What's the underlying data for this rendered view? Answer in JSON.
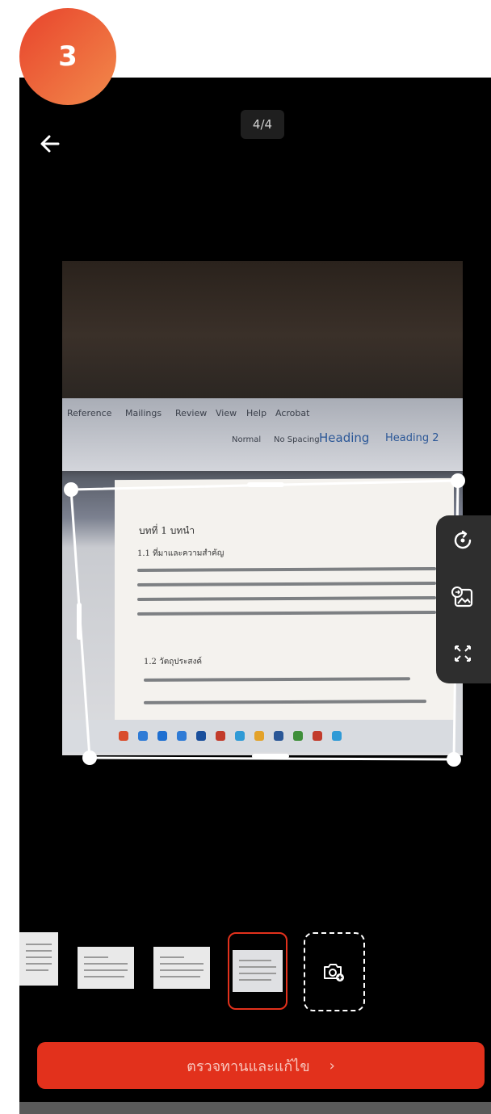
{
  "step": {
    "number": "3"
  },
  "header": {
    "back_icon": "arrow-left-icon",
    "page_indicator": "4/4"
  },
  "document_photo": {
    "ribbon_tabs": [
      "Reference",
      "Mailings",
      "Review",
      "View",
      "Help",
      "Acrobat"
    ],
    "styles": [
      "Normal",
      "No Spacing",
      "Heading",
      "Heading 2"
    ],
    "heading": "บทที่ 1 บทนำ",
    "section_1": "1.1 ที่มาและความสำคัญ",
    "section_2": "1.2 วัตถุประสงค์"
  },
  "toolbar": {
    "rotate_icon": "rotate-icon",
    "image_filter_icon": "image-filter-icon",
    "auto_crop_icon": "expand-crop-icon"
  },
  "thumbnails": {
    "count": 4,
    "selected_index": 3,
    "add_icon": "add-camera-icon"
  },
  "review_button": {
    "label": "ตรวจทานและแก้ไข",
    "chevron": "›"
  },
  "colors": {
    "accent": "#e2311c",
    "badge_start": "#e8432c",
    "badge_end": "#f28a4b"
  }
}
